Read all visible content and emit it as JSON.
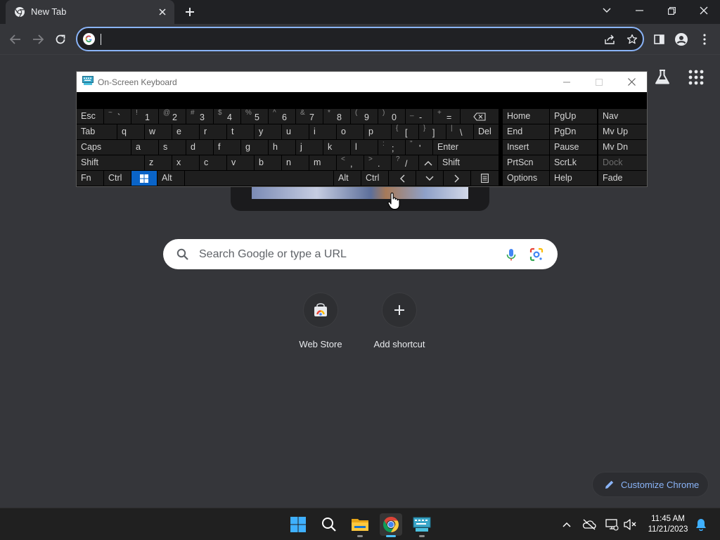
{
  "browser": {
    "tab_title": "New Tab",
    "omnibox_value": ""
  },
  "ntp": {
    "search_placeholder": "Search Google or type a URL",
    "shortcuts": [
      {
        "label": "Web Store",
        "icon": "web-store-icon"
      },
      {
        "label": "Add shortcut",
        "icon": "plus-icon"
      }
    ],
    "customize_label": "Customize Chrome"
  },
  "osk": {
    "title": "On-Screen Keyboard",
    "rows": [
      [
        {
          "m": "Esc"
        },
        {
          "s": "~",
          "p": "`"
        },
        {
          "s": "!",
          "p": "1"
        },
        {
          "s": "@",
          "p": "2"
        },
        {
          "s": "#",
          "p": "3"
        },
        {
          "s": "$",
          "p": "4"
        },
        {
          "s": "%",
          "p": "5"
        },
        {
          "s": "^",
          "p": "6"
        },
        {
          "s": "&",
          "p": "7"
        },
        {
          "s": "*",
          "p": "8"
        },
        {
          "s": "(",
          "p": "9"
        },
        {
          "s": ")",
          "p": "0"
        },
        {
          "s": "_",
          "p": "-"
        },
        {
          "s": "+",
          "p": "="
        },
        {
          "icon": "backspace-icon"
        }
      ],
      [
        {
          "m": "Tab"
        },
        {
          "m": "q"
        },
        {
          "m": "w"
        },
        {
          "m": "e"
        },
        {
          "m": "r"
        },
        {
          "m": "t"
        },
        {
          "m": "y"
        },
        {
          "m": "u"
        },
        {
          "m": "i"
        },
        {
          "m": "o"
        },
        {
          "m": "p"
        },
        {
          "s": "{",
          "p": "["
        },
        {
          "s": "}",
          "p": "]"
        },
        {
          "s": "|",
          "p": "\\"
        },
        {
          "m": "Del"
        }
      ],
      [
        {
          "m": "Caps"
        },
        {
          "m": "a"
        },
        {
          "m": "s"
        },
        {
          "m": "d"
        },
        {
          "m": "f"
        },
        {
          "m": "g"
        },
        {
          "m": "h"
        },
        {
          "m": "j"
        },
        {
          "m": "k"
        },
        {
          "m": "l"
        },
        {
          "s": ":",
          "p": ";"
        },
        {
          "s": "\"",
          "p": "'"
        },
        {
          "m": "Enter"
        }
      ],
      [
        {
          "m": "Shift"
        },
        {
          "m": "z"
        },
        {
          "m": "x"
        },
        {
          "m": "c"
        },
        {
          "m": "v"
        },
        {
          "m": "b"
        },
        {
          "m": "n"
        },
        {
          "m": "m"
        },
        {
          "s": "<",
          "p": ","
        },
        {
          "s": ">",
          "p": "."
        },
        {
          "s": "?",
          "p": "/"
        },
        {
          "icon": "arrow-up-icon"
        },
        {
          "m": "Shift"
        }
      ],
      [
        {
          "m": "Fn"
        },
        {
          "m": "Ctrl"
        },
        {
          "icon": "windows-logo-icon"
        },
        {
          "m": "Alt"
        },
        {
          "m": ""
        },
        {
          "m": "Alt"
        },
        {
          "m": "Ctrl"
        },
        {
          "icon": "arrow-left-icon"
        },
        {
          "icon": "arrow-down-icon"
        },
        {
          "icon": "arrow-right-icon"
        },
        {
          "icon": "menu-key-icon"
        }
      ]
    ],
    "nav_keys": [
      [
        "Home",
        "PgUp",
        "Nav"
      ],
      [
        "End",
        "PgDn",
        "Mv Up"
      ],
      [
        "Insert",
        "Pause",
        "Mv Dn"
      ],
      [
        "PrtScn",
        "ScrLk",
        "Dock"
      ],
      [
        "Options",
        "Help",
        "Fade"
      ]
    ],
    "disabled_keys": [
      "Dock"
    ]
  },
  "taskbar": {
    "apps": [
      "windows-start-icon",
      "search-icon",
      "file-explorer-icon",
      "chrome-icon",
      "on-screen-keyboard-icon"
    ],
    "time": "11:45 AM",
    "date": "11/21/2023"
  },
  "colors": {
    "accent": "#8ab4f8",
    "page_bg": "#35363a",
    "windows_blue": "#0a64c8"
  }
}
